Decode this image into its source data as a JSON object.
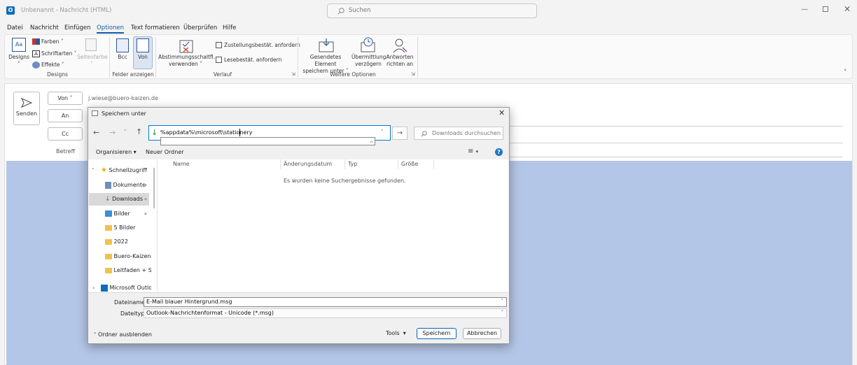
{
  "window": {
    "title": "Unbenannt - Nachricht (HTML)",
    "search_placeholder": "Suchen"
  },
  "menu": [
    "Datei",
    "Nachricht",
    "Einfügen",
    "Optionen",
    "Text formatieren",
    "Überprüfen",
    "Hilfe"
  ],
  "ribbon": {
    "designs": "Designs",
    "farben": "Farben",
    "schriftarten": "Schriftarten",
    "effekte": "Effekte",
    "seitenfarbe": "Seitenfarbe",
    "grp_designs": "Designs",
    "bcc": "Bcc",
    "von": "Von",
    "grp_felder": "Felder anzeigen",
    "abstimmung_1": "Abstimmungsschaltfl.",
    "abstimmung_2": "verwenden",
    "zustellung": "Zustellungsbestät. anfordern",
    "lesebest": "Lesebestät. anfordern",
    "grp_verlauf": "Verlauf",
    "gesendetes_1": "Gesendetes Element",
    "gesendetes_2": "speichern unter",
    "uebermittlung_1": "Übermittlung",
    "uebermittlung_2": "verzögern",
    "antworten_1": "Antworten",
    "antworten_2": "richten an",
    "grp_weitere": "Weitere Optionen"
  },
  "compose": {
    "send": "Senden",
    "from": "Von",
    "to": "An",
    "cc": "Cc",
    "subject": "Betreff",
    "from_address": "j.wiese@buero-kaizen.de"
  },
  "dialog": {
    "title": "Speichern unter",
    "address": "%appdata%\\microsoft\\stationery",
    "search_placeholder": "Downloads durchsuchen",
    "organize": "Organisieren",
    "new_folder": "Neuer Ordner",
    "nav": [
      "Schnellzugriff",
      "Dokumente",
      "Downloads",
      "Bilder",
      "5 Bilder",
      "2022",
      "Buero-Kaizen -",
      "Leitfaden + Spi",
      "Microsoft Outloo"
    ],
    "columns": [
      "Name",
      "Änderungsdatum",
      "Typ",
      "Größe"
    ],
    "empty": "Es wurden keine Suchergebnisse gefunden.",
    "filename_label": "Dateiname:",
    "filename": "E-Mail blauer Hintergrund.msg",
    "filetype_label": "Dateityp:",
    "filetype": "Outlook-Nachrichtenformat - Unicode (*.msg)",
    "hide_folders": "Ordner ausblenden",
    "tools": "Tools",
    "save": "Speichern",
    "cancel": "Abbrechen"
  },
  "colors": {
    "accent": "#0f5ca8",
    "body_bg": "#b4c6e7"
  }
}
